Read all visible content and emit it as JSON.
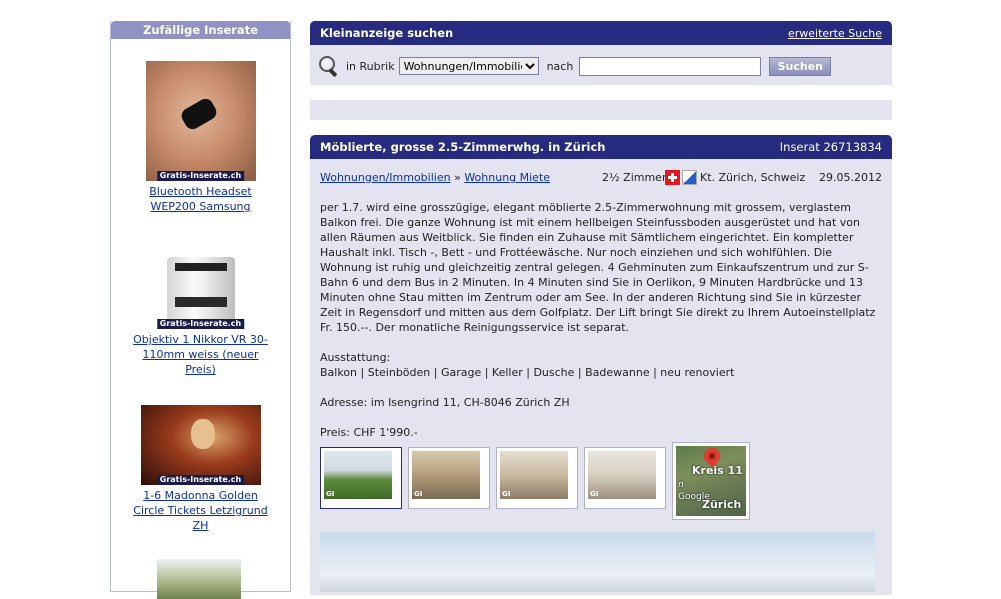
{
  "sidebar": {
    "title": "Zufällige Inserate",
    "watermark": "Gratis-Inserate.ch",
    "ads": [
      {
        "title": "Bluetooth Headset WEP200 Samsung",
        "image": "headset-photo"
      },
      {
        "title": "Objektiv 1 Nikkor VR 30-110mm weiss (neuer Preis)",
        "image": "lens-photo"
      },
      {
        "title": "1-6 Madonna Golden Circle Tickets Letzigrund ZH",
        "image": "concert-photo"
      }
    ]
  },
  "search": {
    "title": "Kleinanzeige suchen",
    "advanced_link": "erweiterte Suche",
    "in_label": "in Rubrik",
    "category_selected": "Wohnungen/Immobilien",
    "after_label": "nach",
    "query_value": "",
    "button_label": "Suchen",
    "icon": "magnifier-icon"
  },
  "listing": {
    "title": "Möblierte, grosse 2.5-Zimmerwhg. in Zürich",
    "id_label": "Inserat 26713834",
    "category": "Wohnungen/Immobilien",
    "separator": "»",
    "subcategory": "Wohnung Miete",
    "rooms": "2½ Zimmer",
    "location": "Kt. Zürich, Schweiz",
    "date": "29.05.2012",
    "description": "per 1.7. wird eine grosszügige, elegant möblierte 2.5-Zimmerwohnung mit grossem, verglastem Balkon frei. Die ganze Wohnung ist mit einem hellbeigen Steinfussboden ausgerüstet und hat von allen Räumen aus Weitblick. Sie finden ein Zuhause mit Sämtlichem eingerichtet. Ein kompletter Haushalt inkl. Tisch -, Bett - und Frottéewäsche. Nur noch einziehen und sich wohlfühlen. Die Wohnung ist ruhig und gleichzeitig zentral gelegen. 4 Gehminuten zum Einkaufszentrum und zur S-Bahn 6 und dem Bus in 2 Minuten. In 4 Minuten sind Sie in Oerlikon, 9 Minuten Hardbrücke und 13 Minuten ohne Stau mitten im Zentrum oder am See. In der anderen Richtung sind Sie in kürzester Zeit in Regensdorf und mitten aus dem Golfplatz. Der Lift bringt Sie direkt zu Ihrem Autoeinstellplatz Fr. 150.--. Der monatliche Reinigungsservice ist separat.",
    "features_label": "Ausstattung:",
    "features": "Balkon | Steinböden | Garage | Keller | Dusche | Badewanne | neu renoviert",
    "address": "Adresse: im Isengrind 11, CH-8046 Zürich ZH",
    "price": "Preis: CHF 1'990.-",
    "photo_badge": "GI",
    "map": {
      "label_top": "Kreis 11",
      "label_bottom": "Zürich",
      "label_left": "Google",
      "label_small": "n"
    }
  }
}
